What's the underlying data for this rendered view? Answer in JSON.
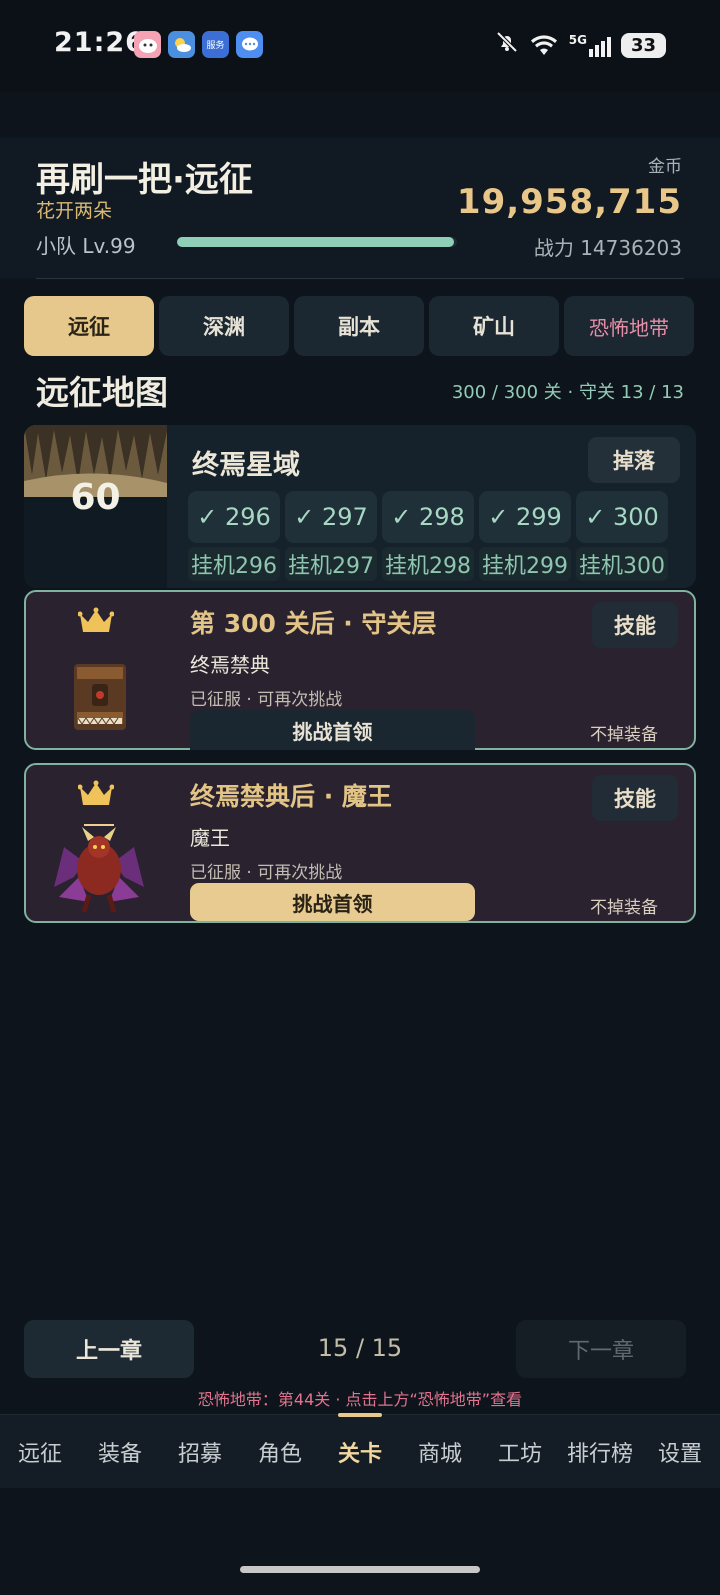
{
  "status_bar": {
    "time": "21:26",
    "battery": "33",
    "network": "5G",
    "app_icons": [
      "pet-app-icon",
      "weather-icon",
      "service-app-icon",
      "message-icon"
    ],
    "service_app_text": "服务"
  },
  "header": {
    "title": "再刷一把·远征",
    "subtitle": "花开两朵",
    "team_level": "小队 Lv.99",
    "xp_progress": 0.99,
    "gold_label": "金币",
    "gold_value": "19,958,715",
    "power": "战力 14736203"
  },
  "tabs": [
    {
      "label": "远征",
      "active": true
    },
    {
      "label": "深渊",
      "active": false
    },
    {
      "label": "副本",
      "active": false
    },
    {
      "label": "矿山",
      "active": false
    },
    {
      "label": "恐怖地带",
      "active": false
    }
  ],
  "map": {
    "title": "远征地图",
    "progress": "300 / 300 关 · 守关 13 / 13"
  },
  "chapter": {
    "number": "60",
    "name": "终焉星域",
    "drop_label": "掉落",
    "stages": [
      {
        "label": "✓ 296",
        "idle": "挂机296"
      },
      {
        "label": "✓ 297",
        "idle": "挂机297"
      },
      {
        "label": "✓ 298",
        "idle": "挂机298"
      },
      {
        "label": "✓ 299",
        "idle": "挂机299"
      },
      {
        "label": "✓ 300",
        "idle": "挂机300"
      }
    ]
  },
  "bosses": [
    {
      "title": "第 300 关后 · 守关层",
      "name": "终焉禁典",
      "status": "已征服 · 可再次挑战",
      "skill_label": "技能",
      "challenge_label": "挑战首领",
      "note": "不掉装备"
    },
    {
      "title": "终焉禁典后 · 魔王",
      "name": "魔王",
      "status": "已征服 · 可再次挑战",
      "skill_label": "技能",
      "challenge_label": "挑战首领",
      "note": "不掉装备"
    }
  ],
  "pager": {
    "prev_label": "上一章",
    "next_label": "下一章",
    "indicator": "15 / 15",
    "hint": "恐怖地带：第44关 · 点击上方“恐怖地带”查看"
  },
  "bottom_nav": [
    {
      "label": "远征",
      "active": false
    },
    {
      "label": "装备",
      "active": false
    },
    {
      "label": "招募",
      "active": false
    },
    {
      "label": "角色",
      "active": false
    },
    {
      "label": "关卡",
      "active": true
    },
    {
      "label": "商城",
      "active": false
    },
    {
      "label": "工坊",
      "active": false
    },
    {
      "label": "排行榜",
      "active": false
    },
    {
      "label": "设置",
      "active": false
    }
  ],
  "colors": {
    "background": "#0d141b",
    "accent_gold": "#e6c88c",
    "accent_teal": "#8fcfb8",
    "danger_pink": "#e2738f",
    "boss_card": "#2a222e"
  }
}
